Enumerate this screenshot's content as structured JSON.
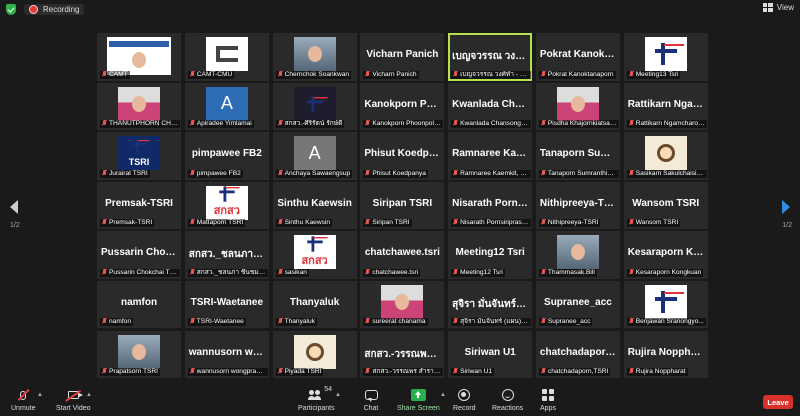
{
  "topbar": {
    "recording_label": "Recording",
    "view_label": "View"
  },
  "paging": {
    "left": "1/2",
    "right": "1/2"
  },
  "tiles": [
    {
      "label": "CAMT",
      "kind": "slide"
    },
    {
      "label": "CAMT-CMU",
      "kind": "camt"
    },
    {
      "label": "Chernchok Soankwan",
      "kind": "photo"
    },
    {
      "label": "Vicharn Panich",
      "name": "Vicharn Panich",
      "kind": "name"
    },
    {
      "label": "เบญจวรรณ วงศ์ทำ - TSRI",
      "name": "เบญจวรรณ วงศ์ทำ",
      "kind": "name",
      "active": true
    },
    {
      "label": "Pokrat Kanoktanaporn",
      "name": "Pokrat Kanoktanaporn",
      "kind": "name"
    },
    {
      "label": "Meeting13 Tsri",
      "kind": "tsri"
    },
    {
      "label": "THANUTPHORN CHA...",
      "kind": "woman"
    },
    {
      "label": "Apiradee Yimlamai",
      "kind": "letter",
      "letter": "A"
    },
    {
      "label": "สกสว.-ศิริรัตน์ รักษ์ดี",
      "kind": "skaw-dark"
    },
    {
      "label": "Kanokporn Phoonpol-...",
      "name": "Kanokporn Phoonpol",
      "kind": "name"
    },
    {
      "label": "Kwanlada Chansongkl...",
      "name": "Kwanlada Chansongkl",
      "kind": "name"
    },
    {
      "label": "Pisdha Khajornkiatsakul",
      "kind": "woman"
    },
    {
      "label": "Rattikarn Ngamcharoe...",
      "name": "Rattikarn Ngamcharoen",
      "kind": "name"
    },
    {
      "label": "Jurairat TSRI",
      "kind": "tsri-blue",
      "text": "TSRI"
    },
    {
      "label": "pimpawee FB2",
      "name": "pimpawee FB2",
      "kind": "name"
    },
    {
      "label": "Anchaya Sawaengsup",
      "kind": "letter-gray",
      "letter": "A"
    },
    {
      "label": "Phisut Koedpanya",
      "name": "Phisut Koedpanya",
      "kind": "name"
    },
    {
      "label": "Ramnaree Kaemkit, TS...",
      "name": "Ramnaree Kaemkit",
      "kind": "name"
    },
    {
      "label": "Tanaporn Sumranthin ...",
      "name": "Tanaporn Sumranthin",
      "kind": "name"
    },
    {
      "label": "Sasikarn Sakulchaisin...",
      "kind": "cartoon"
    },
    {
      "label": "Premsak-TSRI",
      "name": "Premsak-TSRI",
      "kind": "name"
    },
    {
      "label": "Mattaporn TSRI",
      "kind": "skaw",
      "text": "สกสว"
    },
    {
      "label": "Sinthu Kaewsin",
      "name": "Sinthu Kaewsin",
      "kind": "name"
    },
    {
      "label": "Siripan TSRI",
      "name": "Siripan TSRI",
      "kind": "name"
    },
    {
      "label": "Nisarath Pornsiriprasert",
      "name": "Nisarath Pornsiriprasert",
      "kind": "name"
    },
    {
      "label": "Nithipreeya-TSRI",
      "name": "Nithipreeya-TSRI",
      "kind": "name"
    },
    {
      "label": "Wansom TSRI",
      "name": "Wansom TSRI",
      "kind": "name"
    },
    {
      "label": "Pussarin Chokchai TSRI",
      "name": "Pussarin Chokchai",
      "kind": "name"
    },
    {
      "label": "สกสว._ชลนภา ชื่นชมจันทร์",
      "name": "สกสว._ชลนภา ชื่นชมจันทร์",
      "kind": "name"
    },
    {
      "label": "sasikan",
      "kind": "skaw",
      "text": "สกสว"
    },
    {
      "label": "chatchawee.tsri",
      "name": "chatchawee.tsri",
      "kind": "name"
    },
    {
      "label": "Meeting12 Tsri",
      "name": "Meeting12 Tsri",
      "kind": "name"
    },
    {
      "label": "Thammasak.Bill",
      "kind": "photo"
    },
    {
      "label": "Kesaraporn Kongkuan",
      "name": "Kesaraporn Kongkuan",
      "kind": "name"
    },
    {
      "label": "namfon",
      "name": "namfon",
      "kind": "name"
    },
    {
      "label": "TSRI-Waetanee",
      "name": "TSRI-Waetanee",
      "kind": "name"
    },
    {
      "label": "Thanyaluk",
      "name": "Thanyaluk",
      "kind": "name"
    },
    {
      "label": "sureerat chanama",
      "kind": "woman"
    },
    {
      "label": "สุจิรา มั่นจันทร์ (แผน) FB6",
      "name": "สุจิรา มั่นจันทร์ (แผน) FB6",
      "kind": "name"
    },
    {
      "label": "Supranee_acc",
      "name": "Supranee_acc",
      "kind": "name"
    },
    {
      "label": "Benjawan Sranongyo...",
      "kind": "tsri"
    },
    {
      "label": "Prapatsorn TSRI",
      "kind": "photo"
    },
    {
      "label": "wannusorn wongprase...",
      "name": "wannusorn wongprasert",
      "kind": "name"
    },
    {
      "label": "Piyada TSRI",
      "kind": "cartoon"
    },
    {
      "label": "สกสว.-วรรณพร สำราญจิตต์",
      "name": "สกสว.-วรรณพร สำราญจิตต์",
      "kind": "name"
    },
    {
      "label": "Siriwan U1",
      "name": "Siriwan U1",
      "kind": "name"
    },
    {
      "label": "chatchadaporn,TSRI",
      "name": "chatchadaporn,TSRI",
      "kind": "name"
    },
    {
      "label": "Rujira Noppharat",
      "name": "Rujira Noppharat",
      "kind": "name"
    }
  ],
  "toolbar": {
    "unmute": "Unmute",
    "start_video": "Start Video",
    "participants": "Participants",
    "participants_count": "54",
    "chat": "Chat",
    "share_screen": "Share Screen",
    "record": "Record",
    "reactions": "Reactions",
    "apps": "Apps",
    "leave": "Leave"
  },
  "colors": {
    "active_speaker": "#b7e04e",
    "leave": "#d9312b",
    "share": "#28b04a"
  }
}
